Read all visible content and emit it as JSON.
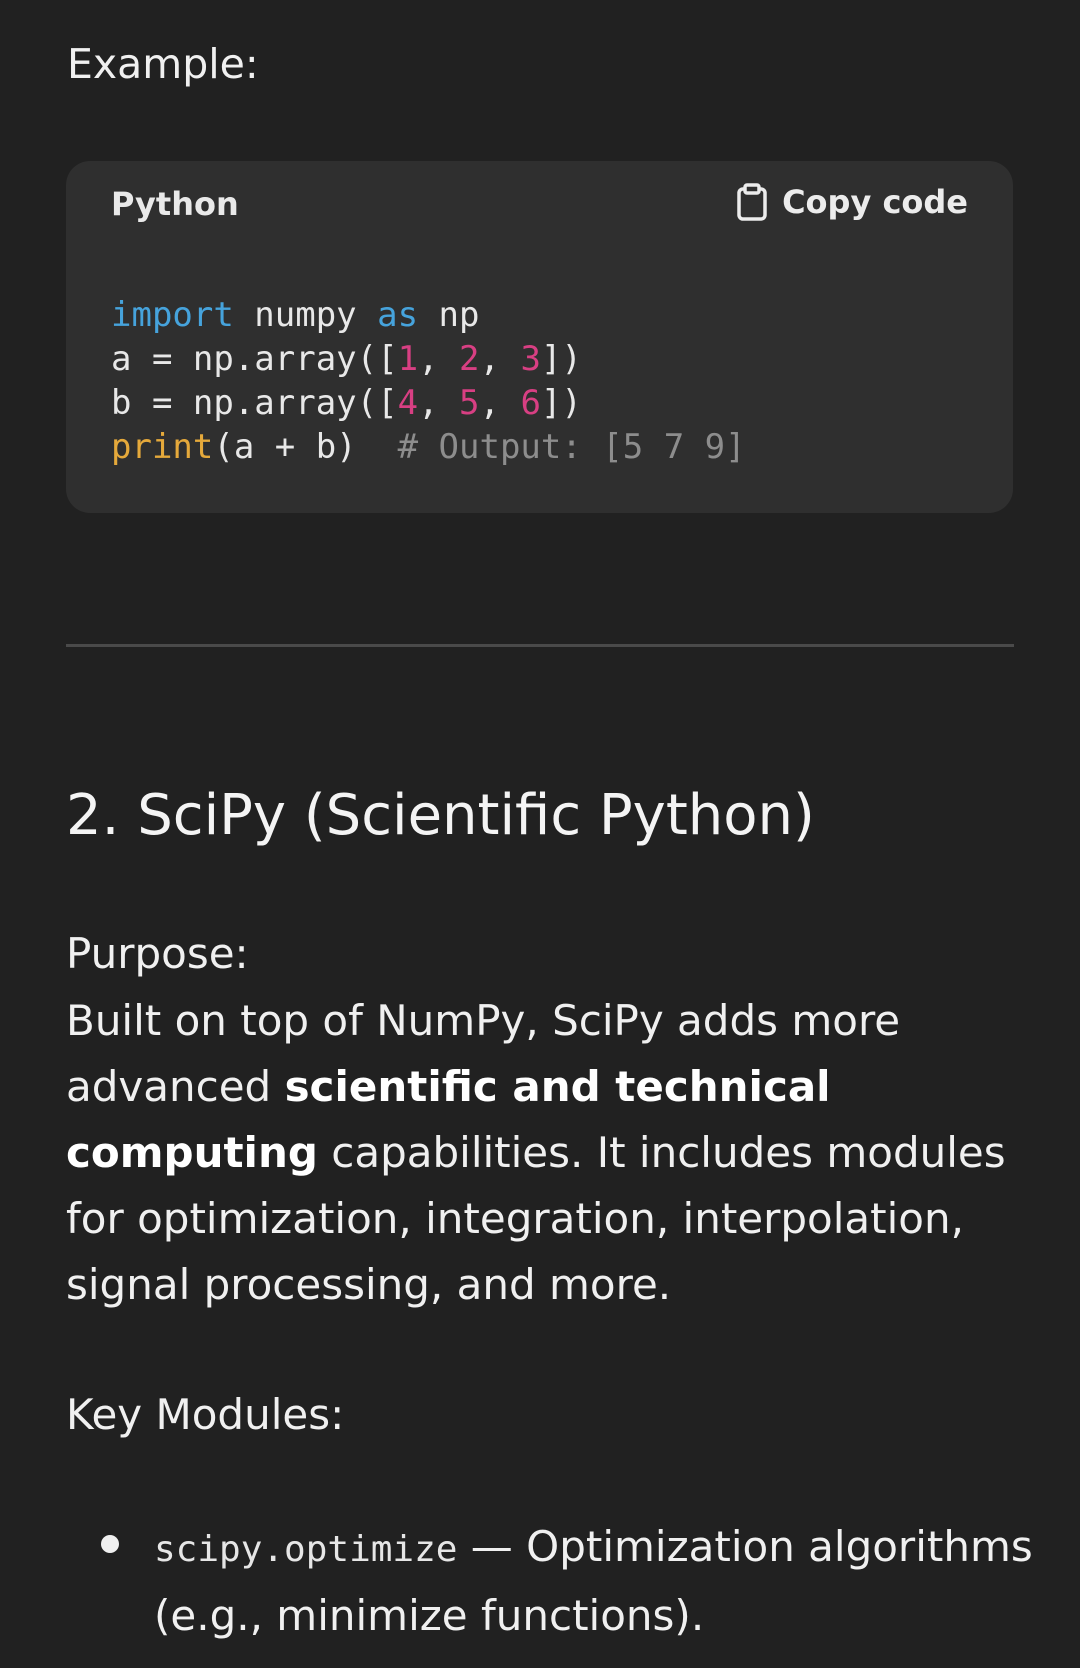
{
  "example": {
    "label": "Example:"
  },
  "code_block": {
    "language": "Python",
    "copy_label": "Copy code",
    "lines": [
      {
        "tokens": [
          {
            "t": "import",
            "c": "kw"
          },
          {
            "t": " numpy ",
            "c": ""
          },
          {
            "t": "as",
            "c": "kw"
          },
          {
            "t": " np",
            "c": ""
          }
        ]
      },
      {
        "tokens": [
          {
            "t": "a = np.array([",
            "c": ""
          },
          {
            "t": "1",
            "c": "num"
          },
          {
            "t": ", ",
            "c": ""
          },
          {
            "t": "2",
            "c": "num"
          },
          {
            "t": ", ",
            "c": ""
          },
          {
            "t": "3",
            "c": "num"
          },
          {
            "t": "])",
            "c": ""
          }
        ]
      },
      {
        "tokens": [
          {
            "t": "b = np.array([",
            "c": ""
          },
          {
            "t": "4",
            "c": "num"
          },
          {
            "t": ", ",
            "c": ""
          },
          {
            "t": "5",
            "c": "num"
          },
          {
            "t": ", ",
            "c": ""
          },
          {
            "t": "6",
            "c": "num"
          },
          {
            "t": "])",
            "c": ""
          }
        ]
      },
      {
        "tokens": [
          {
            "t": "print",
            "c": "fn"
          },
          {
            "t": "(a + b)  ",
            "c": ""
          },
          {
            "t": "# Output: [5 7 9]",
            "c": "cm"
          }
        ]
      }
    ]
  },
  "section": {
    "title": "2. SciPy (Scientific Python)"
  },
  "purpose": {
    "label": "Purpose:",
    "text_before": "Built on top of NumPy, SciPy adds more advanced ",
    "text_bold": "scientific and technical computing",
    "text_after": " capabilities. It includes modules for optimization, integration, interpolation, signal processing, and more."
  },
  "key_modules": {
    "label": "Key Modules:",
    "items": [
      {
        "code": "scipy.optimize",
        "description": " — Optimization algorithms (e.g., minimize functions)."
      }
    ]
  },
  "colors": {
    "background": "#212121",
    "code_background": "#2f2f2f",
    "keyword": "#46a3dc",
    "number": "#d83f83",
    "builtin": "#e5a93b",
    "comment": "#8d8d8d"
  },
  "icons": {
    "copy": "clipboard-icon"
  }
}
